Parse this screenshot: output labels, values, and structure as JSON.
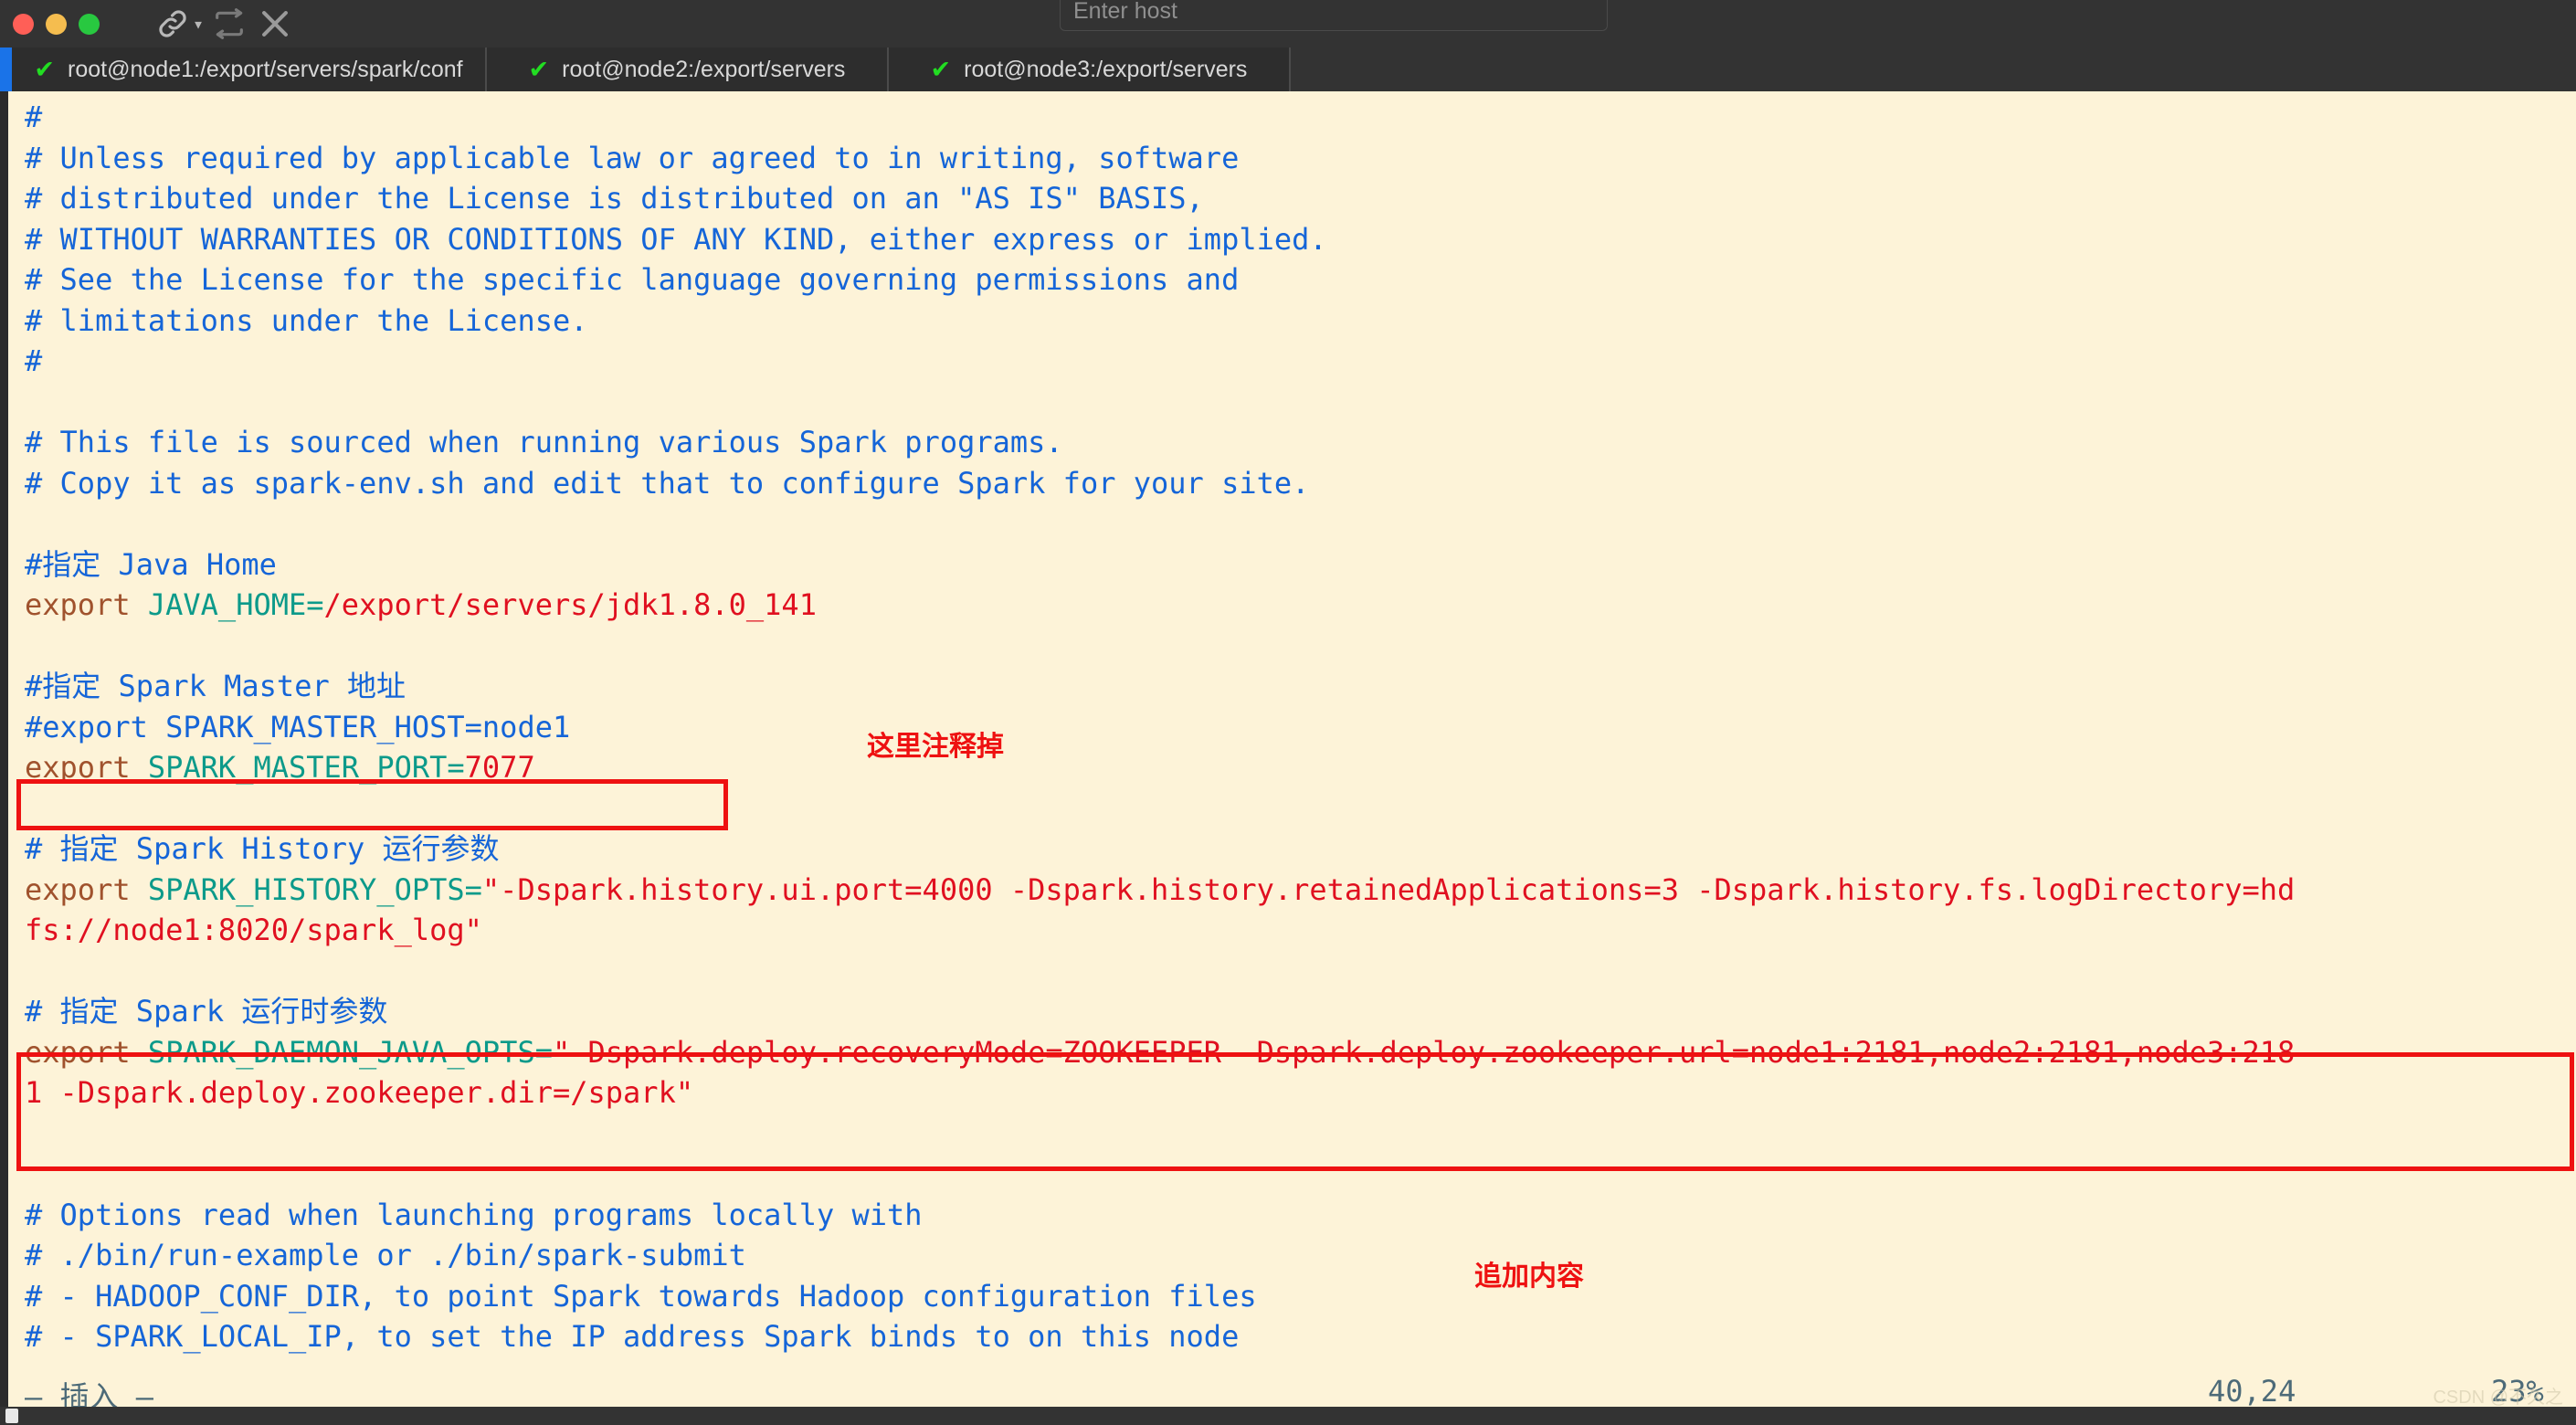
{
  "window": {
    "traffic_lights": [
      "close",
      "minimize",
      "maximize"
    ],
    "toolbar": {
      "link_label": "⚗",
      "chevron_label": "⌄",
      "sync_label": "↻",
      "close_label": "✕"
    },
    "host_field": {
      "placeholder": "Enter host",
      "value": ""
    }
  },
  "tabs": [
    {
      "check": "✔",
      "label": "root@node1:/export/servers/spark/conf",
      "active": true
    },
    {
      "check": "✔",
      "label": "root@node2:/export/servers",
      "active": false
    },
    {
      "check": "✔",
      "label": "root@node3:/export/servers",
      "active": false
    }
  ],
  "editor": {
    "lines": [
      {
        "segs": [
          {
            "t": "#",
            "c": "cmt"
          }
        ]
      },
      {
        "segs": [
          {
            "t": "# Unless required by applicable law or agreed to in writing, software",
            "c": "cmt"
          }
        ]
      },
      {
        "segs": [
          {
            "t": "# distributed under the License is distributed on an \"AS IS\" BASIS,",
            "c": "cmt"
          }
        ]
      },
      {
        "segs": [
          {
            "t": "# WITHOUT WARRANTIES OR CONDITIONS OF ANY KIND, either express or implied.",
            "c": "cmt"
          }
        ]
      },
      {
        "segs": [
          {
            "t": "# See the License for the specific language governing permissions and",
            "c": "cmt"
          }
        ]
      },
      {
        "segs": [
          {
            "t": "# limitations under the License.",
            "c": "cmt"
          }
        ]
      },
      {
        "segs": [
          {
            "t": "#",
            "c": "cmt"
          }
        ]
      },
      {
        "segs": []
      },
      {
        "segs": [
          {
            "t": "# This file is sourced when running various Spark programs.",
            "c": "cmt"
          }
        ]
      },
      {
        "segs": [
          {
            "t": "# Copy it as spark-env.sh and edit that to configure Spark for your site.",
            "c": "cmt"
          }
        ]
      },
      {
        "segs": []
      },
      {
        "segs": [
          {
            "t": "#指定 Java Home",
            "c": "cmt"
          }
        ]
      },
      {
        "segs": [
          {
            "t": "export ",
            "c": "kw"
          },
          {
            "t": "JAVA_HOME=",
            "c": "var"
          },
          {
            "t": "/export/servers/jdk1.8.0_141",
            "c": "val"
          }
        ]
      },
      {
        "segs": []
      },
      {
        "segs": [
          {
            "t": "#指定 Spark Master 地址",
            "c": "cmt"
          }
        ]
      },
      {
        "segs": [
          {
            "t": "#export SPARK_MASTER_HOST=node1",
            "c": "cmt"
          }
        ]
      },
      {
        "segs": [
          {
            "t": "export ",
            "c": "kw"
          },
          {
            "t": "SPARK_MASTER_PORT=",
            "c": "var"
          },
          {
            "t": "7077",
            "c": "val"
          }
        ]
      },
      {
        "segs": []
      },
      {
        "segs": [
          {
            "t": "# 指定 Spark History 运行参数",
            "c": "cmt"
          }
        ]
      },
      {
        "segs": [
          {
            "t": "export ",
            "c": "kw"
          },
          {
            "t": "SPARK_HISTORY_OPTS=",
            "c": "var"
          },
          {
            "t": "\"-Dspark.history.ui.port=4000 -Dspark.history.retainedApplications=3 -Dspark.history.fs.logDirectory=hd",
            "c": "val"
          }
        ]
      },
      {
        "segs": [
          {
            "t": "fs://node1:8020/spark_log\"",
            "c": "val"
          }
        ]
      },
      {
        "segs": []
      },
      {
        "segs": [
          {
            "t": "# 指定 Spark 运行时参数",
            "c": "cmt"
          }
        ]
      },
      {
        "segs": [
          {
            "t": "export ",
            "c": "kw"
          },
          {
            "t": "SPARK_DAEMON_JAVA_OPTS=",
            "c": "var"
          },
          {
            "t": "\"-Dspark.deploy.recoveryMode=ZOOKEEPER -Dspark.deploy.zookeeper.url=node1:2181,node2:2181,node3:218",
            "c": "val"
          }
        ]
      },
      {
        "segs": [
          {
            "t": "1 -Dspark.deploy.zookeeper.dir=/spark\"",
            "c": "val"
          }
        ]
      },
      {
        "segs": []
      },
      {
        "segs": []
      },
      {
        "segs": [
          {
            "t": "# Options read when launching programs locally with",
            "c": "cmt"
          }
        ]
      },
      {
        "segs": [
          {
            "t": "# ./bin/run-example or ./bin/spark-submit",
            "c": "cmt"
          }
        ]
      },
      {
        "segs": [
          {
            "t": "# - HADOOP_CONF_DIR, to point Spark towards Hadoop configuration files",
            "c": "cmt"
          }
        ]
      },
      {
        "segs": [
          {
            "t": "# - SPARK_LOCAL_IP, to set the IP address Spark binds to on this node",
            "c": "cmt"
          }
        ]
      }
    ],
    "status": {
      "mode": "— 插入 —",
      "position": "40,24",
      "percent": "23%"
    }
  },
  "annotations": [
    {
      "text": "这里注释掉"
    },
    {
      "text": "追加内容"
    }
  ],
  "colors": {
    "terminal_bg": "#fdf3d8",
    "comment": "#1565d8",
    "keyword": "#a0522d",
    "variable": "#0c9a8a",
    "value": "#e01020",
    "annotation": "#ee1111",
    "tab_accent": "#1a73e8",
    "status_text": "#4c6a78"
  },
  "watermark": {
    "text": "CSDN @不久之"
  },
  "taskbar": {
    "text": ""
  }
}
